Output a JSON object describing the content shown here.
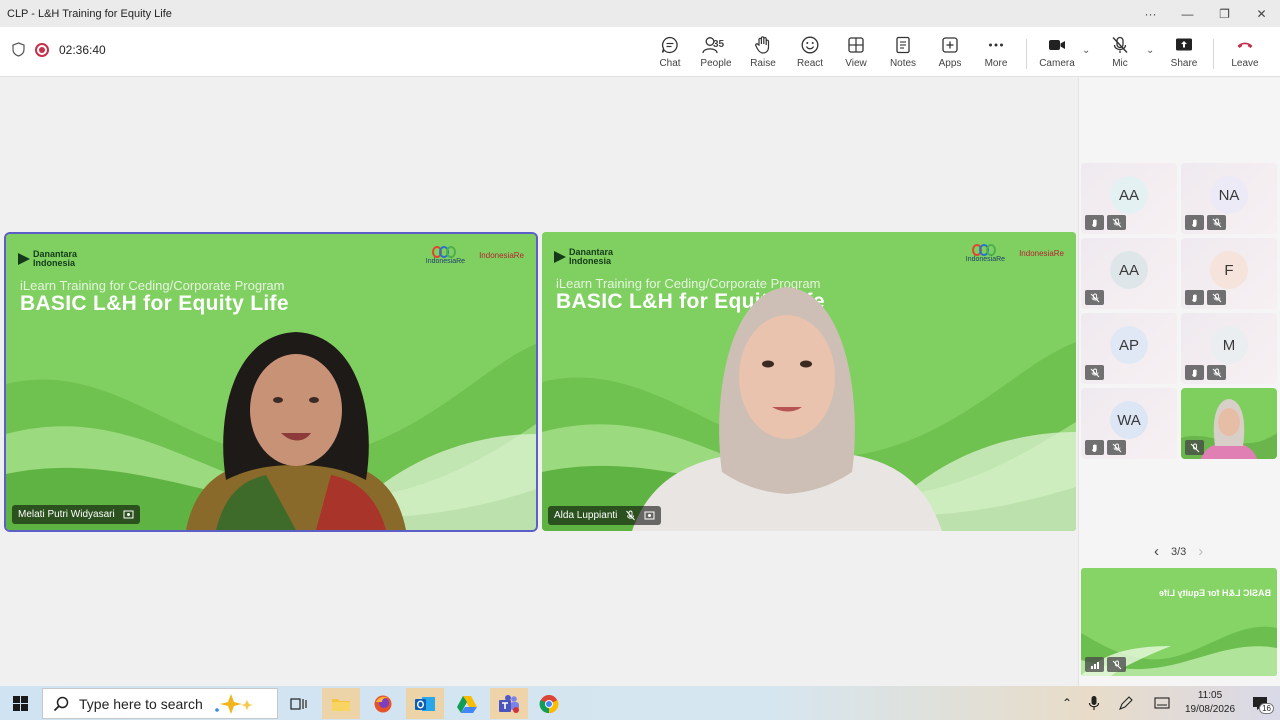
{
  "window": {
    "title": "CLP - L&H Training for Equity Life",
    "controls": [
      "···",
      "—",
      "❐",
      "✕"
    ]
  },
  "meeting": {
    "timer": "02:36:40"
  },
  "toolbar": {
    "chat": "Chat",
    "people": "People",
    "people_count": "35",
    "raise": "Raise",
    "react": "React",
    "view": "View",
    "notes": "Notes",
    "apps": "Apps",
    "more": "More",
    "camera": "Camera",
    "mic": "Mic",
    "share": "Share",
    "leave": "Leave"
  },
  "slide": {
    "logo_left_line1": "Danantara",
    "logo_left_line2": "Indonesia",
    "logo_ir": "IndonesiaRe",
    "logo_ir2": "IndonesiaRe",
    "subtitle": "iLearn Training for Ceding/Corporate Program",
    "title": "BASIC L&H for Equity Life"
  },
  "videos": [
    {
      "name": "Melati Putri Widyasari"
    },
    {
      "name": "Alda Luppianti"
    }
  ],
  "participants": [
    {
      "initials": "AA",
      "color": "#e3f1f3"
    },
    {
      "initials": "NA",
      "color": "#eceaf6"
    },
    {
      "initials": "AA",
      "color": "#dfe6ea"
    },
    {
      "initials": "F",
      "color": "#f5e3dc"
    },
    {
      "initials": "AP",
      "color": "#e0e8f6"
    },
    {
      "initials": "M",
      "color": "#eaeef0"
    },
    {
      "initials": "WA",
      "color": "#dde6f5"
    }
  ],
  "pager": {
    "label": "3/3"
  },
  "taskbar": {
    "search_placeholder": "Type here to search",
    "time": "11:05",
    "date": "19/08/2026",
    "notifications": "16"
  },
  "colors": {
    "accent": "#5b5fc7",
    "leave": "#c4314b",
    "slide_green": "#7fcf5e"
  }
}
